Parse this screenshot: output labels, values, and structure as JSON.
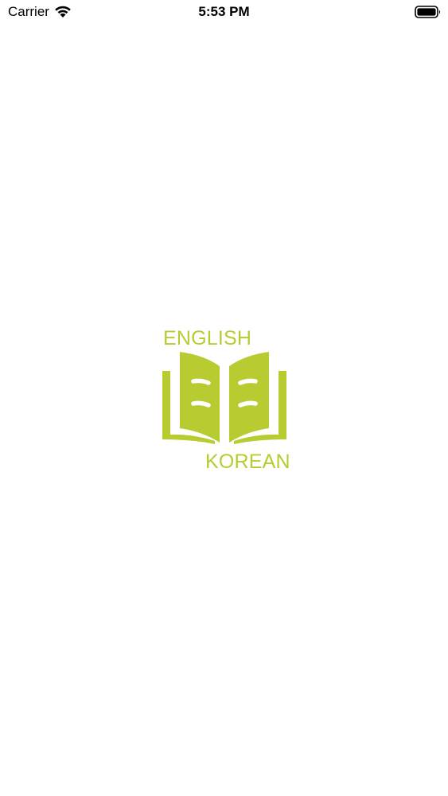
{
  "status_bar": {
    "carrier": "Carrier",
    "time": "5:53 PM",
    "wifi_icon": "wifi-icon",
    "battery_icon": "battery-icon"
  },
  "splash": {
    "top_text": "ENGLISH",
    "bottom_text": "KOREAN",
    "logo_icon": "open-book-icon",
    "brand_color": "#b8cc32"
  }
}
